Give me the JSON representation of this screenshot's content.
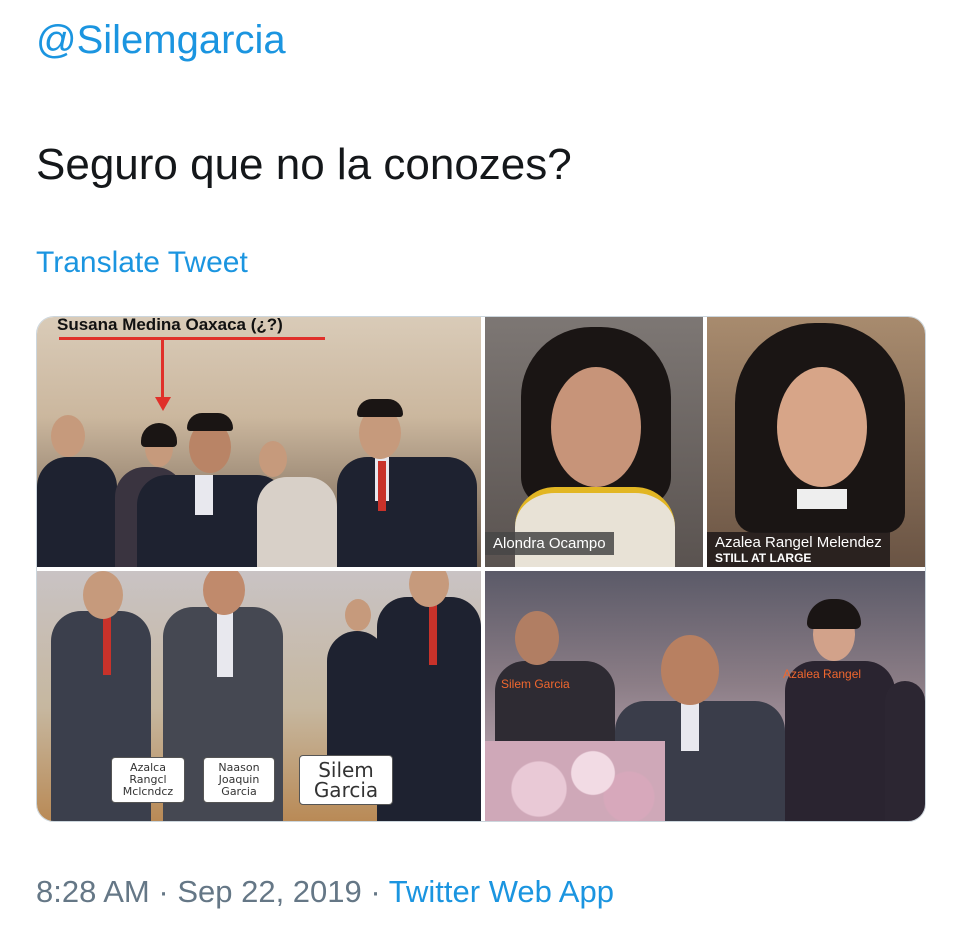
{
  "tweet": {
    "handle": "@Silemgarcia",
    "text": "Seguro que no la conozes?",
    "translate_label": "Translate Tweet",
    "time": "8:28 AM",
    "separator": "·",
    "date": "Sep 22, 2019",
    "source": "Twitter Web App"
  },
  "media": {
    "photo1": {
      "caption": "Susana Medina Oaxaca (¿?)"
    },
    "photo2": {
      "caption": "Alondra Ocampo"
    },
    "photo3": {
      "caption": "Azalea Rangel Melendez",
      "subcaption": "STILL AT LARGE"
    },
    "photo4": {
      "labels": [
        "Azalca Rangcl Mclcndcz",
        "Naason Joaquin Garcia",
        "Silem Garcia"
      ]
    },
    "photo5": {
      "labels": [
        "Silem Garcia",
        "Azalea Rangel"
      ]
    }
  },
  "colors": {
    "link": "#1b95e0",
    "text": "#14171a",
    "meta": "#657786",
    "highlight_red": "#e0302a"
  }
}
